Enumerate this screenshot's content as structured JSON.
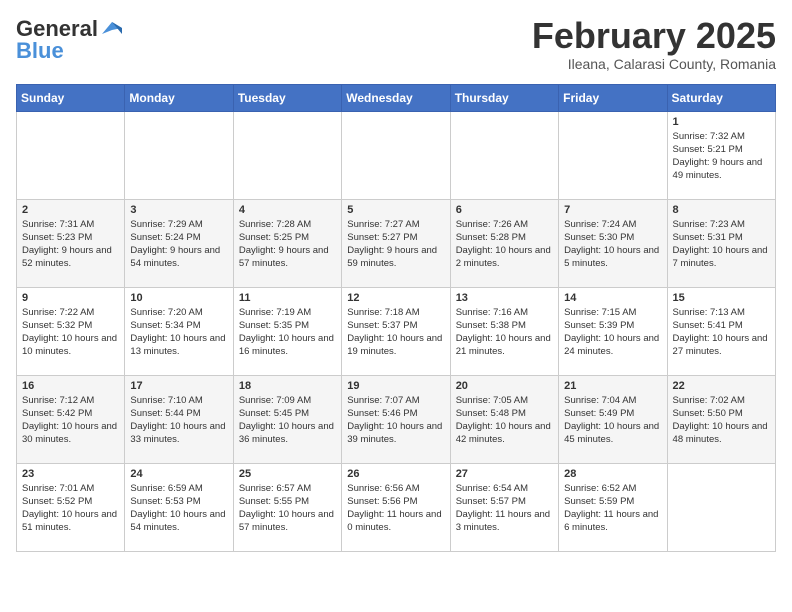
{
  "header": {
    "logo_general": "General",
    "logo_blue": "Blue",
    "month": "February 2025",
    "location": "Ileana, Calarasi County, Romania"
  },
  "weekdays": [
    "Sunday",
    "Monday",
    "Tuesday",
    "Wednesday",
    "Thursday",
    "Friday",
    "Saturday"
  ],
  "weeks": [
    [
      {
        "day": "",
        "sunrise": "",
        "sunset": "",
        "daylight": ""
      },
      {
        "day": "",
        "sunrise": "",
        "sunset": "",
        "daylight": ""
      },
      {
        "day": "",
        "sunrise": "",
        "sunset": "",
        "daylight": ""
      },
      {
        "day": "",
        "sunrise": "",
        "sunset": "",
        "daylight": ""
      },
      {
        "day": "",
        "sunrise": "",
        "sunset": "",
        "daylight": ""
      },
      {
        "day": "",
        "sunrise": "",
        "sunset": "",
        "daylight": ""
      },
      {
        "day": "1",
        "sunrise": "Sunrise: 7:32 AM",
        "sunset": "Sunset: 5:21 PM",
        "daylight": "Daylight: 9 hours and 49 minutes."
      }
    ],
    [
      {
        "day": "2",
        "sunrise": "Sunrise: 7:31 AM",
        "sunset": "Sunset: 5:23 PM",
        "daylight": "Daylight: 9 hours and 52 minutes."
      },
      {
        "day": "3",
        "sunrise": "Sunrise: 7:29 AM",
        "sunset": "Sunset: 5:24 PM",
        "daylight": "Daylight: 9 hours and 54 minutes."
      },
      {
        "day": "4",
        "sunrise": "Sunrise: 7:28 AM",
        "sunset": "Sunset: 5:25 PM",
        "daylight": "Daylight: 9 hours and 57 minutes."
      },
      {
        "day": "5",
        "sunrise": "Sunrise: 7:27 AM",
        "sunset": "Sunset: 5:27 PM",
        "daylight": "Daylight: 9 hours and 59 minutes."
      },
      {
        "day": "6",
        "sunrise": "Sunrise: 7:26 AM",
        "sunset": "Sunset: 5:28 PM",
        "daylight": "Daylight: 10 hours and 2 minutes."
      },
      {
        "day": "7",
        "sunrise": "Sunrise: 7:24 AM",
        "sunset": "Sunset: 5:30 PM",
        "daylight": "Daylight: 10 hours and 5 minutes."
      },
      {
        "day": "8",
        "sunrise": "Sunrise: 7:23 AM",
        "sunset": "Sunset: 5:31 PM",
        "daylight": "Daylight: 10 hours and 7 minutes."
      }
    ],
    [
      {
        "day": "9",
        "sunrise": "Sunrise: 7:22 AM",
        "sunset": "Sunset: 5:32 PM",
        "daylight": "Daylight: 10 hours and 10 minutes."
      },
      {
        "day": "10",
        "sunrise": "Sunrise: 7:20 AM",
        "sunset": "Sunset: 5:34 PM",
        "daylight": "Daylight: 10 hours and 13 minutes."
      },
      {
        "day": "11",
        "sunrise": "Sunrise: 7:19 AM",
        "sunset": "Sunset: 5:35 PM",
        "daylight": "Daylight: 10 hours and 16 minutes."
      },
      {
        "day": "12",
        "sunrise": "Sunrise: 7:18 AM",
        "sunset": "Sunset: 5:37 PM",
        "daylight": "Daylight: 10 hours and 19 minutes."
      },
      {
        "day": "13",
        "sunrise": "Sunrise: 7:16 AM",
        "sunset": "Sunset: 5:38 PM",
        "daylight": "Daylight: 10 hours and 21 minutes."
      },
      {
        "day": "14",
        "sunrise": "Sunrise: 7:15 AM",
        "sunset": "Sunset: 5:39 PM",
        "daylight": "Daylight: 10 hours and 24 minutes."
      },
      {
        "day": "15",
        "sunrise": "Sunrise: 7:13 AM",
        "sunset": "Sunset: 5:41 PM",
        "daylight": "Daylight: 10 hours and 27 minutes."
      }
    ],
    [
      {
        "day": "16",
        "sunrise": "Sunrise: 7:12 AM",
        "sunset": "Sunset: 5:42 PM",
        "daylight": "Daylight: 10 hours and 30 minutes."
      },
      {
        "day": "17",
        "sunrise": "Sunrise: 7:10 AM",
        "sunset": "Sunset: 5:44 PM",
        "daylight": "Daylight: 10 hours and 33 minutes."
      },
      {
        "day": "18",
        "sunrise": "Sunrise: 7:09 AM",
        "sunset": "Sunset: 5:45 PM",
        "daylight": "Daylight: 10 hours and 36 minutes."
      },
      {
        "day": "19",
        "sunrise": "Sunrise: 7:07 AM",
        "sunset": "Sunset: 5:46 PM",
        "daylight": "Daylight: 10 hours and 39 minutes."
      },
      {
        "day": "20",
        "sunrise": "Sunrise: 7:05 AM",
        "sunset": "Sunset: 5:48 PM",
        "daylight": "Daylight: 10 hours and 42 minutes."
      },
      {
        "day": "21",
        "sunrise": "Sunrise: 7:04 AM",
        "sunset": "Sunset: 5:49 PM",
        "daylight": "Daylight: 10 hours and 45 minutes."
      },
      {
        "day": "22",
        "sunrise": "Sunrise: 7:02 AM",
        "sunset": "Sunset: 5:50 PM",
        "daylight": "Daylight: 10 hours and 48 minutes."
      }
    ],
    [
      {
        "day": "23",
        "sunrise": "Sunrise: 7:01 AM",
        "sunset": "Sunset: 5:52 PM",
        "daylight": "Daylight: 10 hours and 51 minutes."
      },
      {
        "day": "24",
        "sunrise": "Sunrise: 6:59 AM",
        "sunset": "Sunset: 5:53 PM",
        "daylight": "Daylight: 10 hours and 54 minutes."
      },
      {
        "day": "25",
        "sunrise": "Sunrise: 6:57 AM",
        "sunset": "Sunset: 5:55 PM",
        "daylight": "Daylight: 10 hours and 57 minutes."
      },
      {
        "day": "26",
        "sunrise": "Sunrise: 6:56 AM",
        "sunset": "Sunset: 5:56 PM",
        "daylight": "Daylight: 11 hours and 0 minutes."
      },
      {
        "day": "27",
        "sunrise": "Sunrise: 6:54 AM",
        "sunset": "Sunset: 5:57 PM",
        "daylight": "Daylight: 11 hours and 3 minutes."
      },
      {
        "day": "28",
        "sunrise": "Sunrise: 6:52 AM",
        "sunset": "Sunset: 5:59 PM",
        "daylight": "Daylight: 11 hours and 6 minutes."
      },
      {
        "day": "",
        "sunrise": "",
        "sunset": "",
        "daylight": ""
      }
    ]
  ]
}
